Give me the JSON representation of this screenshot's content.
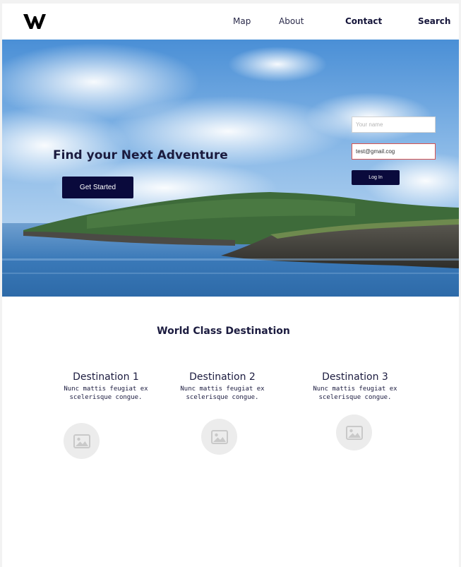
{
  "header": {
    "nav": {
      "map": "Map",
      "about": "About",
      "contact": "Contact",
      "search": "Search"
    }
  },
  "hero": {
    "title": "Find your Next Adventure",
    "cta_label": "Get Started",
    "login_form": {
      "name_placeholder": "Your name",
      "email_value": "test@gmail.cog",
      "login_label": "Log In"
    }
  },
  "section": {
    "title": "World Class Destination",
    "destinations": [
      {
        "title": "Destination 1",
        "description": "Nunc mattis feugiat ex scelerisque congue."
      },
      {
        "title": "Destination 2",
        "description": "Nunc mattis feugiat ex scelerisque congue."
      },
      {
        "title": "Destination 3",
        "description": "Nunc mattis feugiat ex scelerisque congue."
      }
    ]
  },
  "colors": {
    "primary": "#0a0a3c",
    "text": "#1b1b3f",
    "error_border": "#d9534f",
    "placeholder_bg": "#ececec"
  },
  "icons": {
    "logo": "w-logo-icon",
    "image_placeholder": "image-icon"
  }
}
